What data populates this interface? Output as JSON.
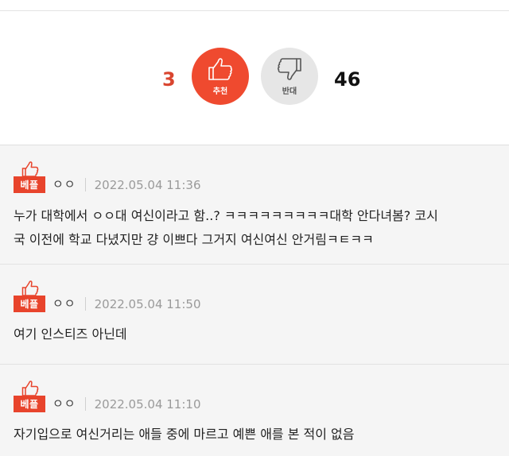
{
  "vote": {
    "up_count": "3",
    "up_label": "추천",
    "down_label": "반대",
    "down_count": "46",
    "up_color": "#ef4a2f",
    "down_color": "#e6e6e6"
  },
  "comments": [
    {
      "badge": "베플",
      "author": "ㅇㅇ",
      "date": "2022.05.04 11:36",
      "text_lines": [
        "누가 대학에서 ㅇㅇ대 여신이라고 함..? ㅋㅋㅋㅋㅋㅋㅋㅋㅋ대학 안다녀봄? 코시",
        "국 이전에 학교 다녔지만 걍 이쁘다 그거지 여신여신 안거림ㅋㅌㅋㅋ"
      ]
    },
    {
      "badge": "베플",
      "author": "ㅇㅇ",
      "date": "2022.05.04 11:50",
      "text_lines": [
        "여기 인스티즈 아닌데"
      ]
    },
    {
      "badge": "베플",
      "author": "ㅇㅇ",
      "date": "2022.05.04 11:10",
      "text_lines": [
        "자기입으로 여신거리는 애들 중에 마르고 예쁜 애를 본 적이 없음"
      ]
    }
  ],
  "icons": {
    "up": "thumbs-up-icon",
    "down": "thumbs-down-icon",
    "badge": "thumbs-up-icon"
  }
}
